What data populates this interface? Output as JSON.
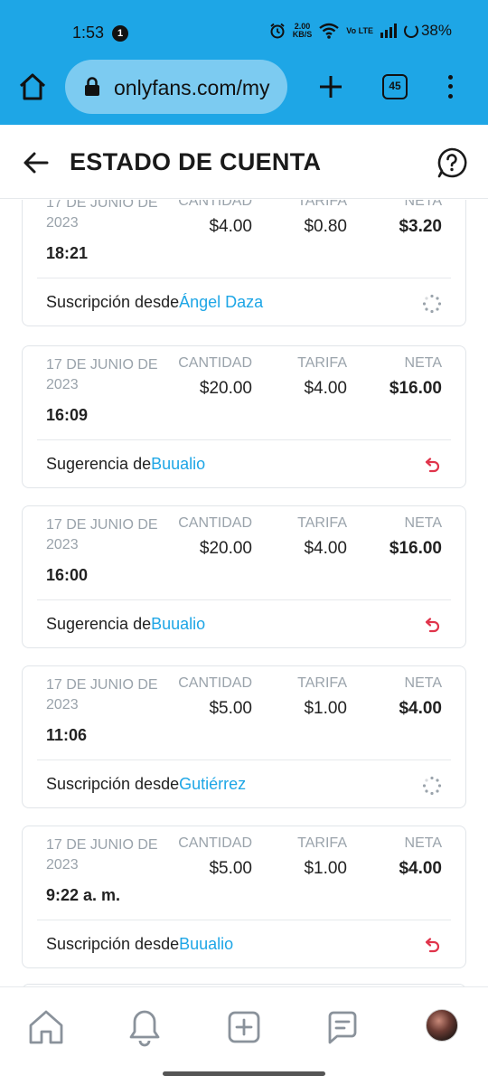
{
  "status_bar": {
    "time": "1:53",
    "notification_count": "1",
    "net_speed_value": "2.00",
    "net_speed_unit": "KB/S",
    "volte": "Vo LTE",
    "battery": "38%"
  },
  "browser": {
    "url": "onlyfans.com/my",
    "tab_count": "45"
  },
  "header": {
    "title": "ESTADO DE CUENTA"
  },
  "columns": {
    "amount": "CANTIDAD",
    "fee": "TARIFA",
    "net": "NETA"
  },
  "transactions": [
    {
      "date": "17 DE JUNIO DE 2023",
      "time": "18:21",
      "amount": "$4.00",
      "fee": "$0.80",
      "net": "$3.20",
      "desc_prefix": "Suscripción desde",
      "user": "Ángel Daza",
      "status": "pending"
    },
    {
      "date": "17 DE JUNIO DE 2023",
      "time": "16:09",
      "amount": "$20.00",
      "fee": "$4.00",
      "net": "$16.00",
      "desc_prefix": "Sugerencia de",
      "user": "Buualio",
      "status": "reversed"
    },
    {
      "date": "17 DE JUNIO DE 2023",
      "time": "16:00",
      "amount": "$20.00",
      "fee": "$4.00",
      "net": "$16.00",
      "desc_prefix": "Sugerencia de",
      "user": "Buualio",
      "status": "reversed"
    },
    {
      "date": "17 DE JUNIO DE 2023",
      "time": "11:06",
      "amount": "$5.00",
      "fee": "$1.00",
      "net": "$4.00",
      "desc_prefix": "Suscripción desde",
      "user": "Gutiérrez",
      "status": "pending"
    },
    {
      "date": "17 DE JUNIO DE 2023",
      "time": "9:22 a. m.",
      "amount": "$5.00",
      "fee": "$1.00",
      "net": "$4.00",
      "desc_prefix": "Suscripción desde",
      "user": "Buualio",
      "status": "reversed"
    }
  ],
  "bottom_nav": [
    "home-icon",
    "bell-icon",
    "plus-square-icon",
    "chat-icon",
    "avatar"
  ],
  "colors": {
    "brand": "#1ea6e6",
    "link": "#1ea6e6",
    "reversed": "#e0344b",
    "muted": "#9aa3ab"
  }
}
